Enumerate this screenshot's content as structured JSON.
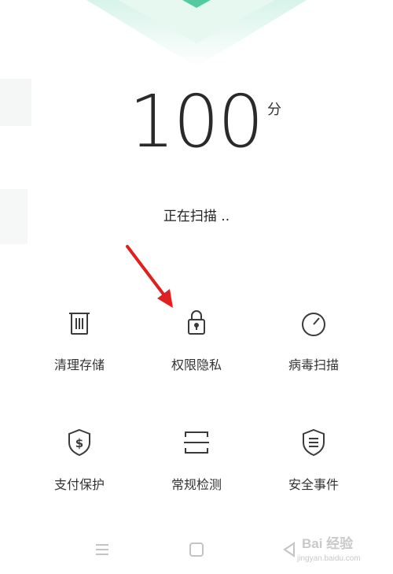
{
  "score": {
    "value": "100",
    "unit": "分"
  },
  "status": {
    "text": "正在扫描 .."
  },
  "tiles": [
    {
      "label": "清理存储",
      "icon": "trash-icon"
    },
    {
      "label": "权限隐私",
      "icon": "lock-icon"
    },
    {
      "label": "病毒扫描",
      "icon": "gauge-icon"
    },
    {
      "label": "支付保护",
      "icon": "shield-dollar-icon"
    },
    {
      "label": "常规检测",
      "icon": "scan-frame-icon"
    },
    {
      "label": "安全事件",
      "icon": "shield-list-icon"
    }
  ],
  "navbar": {
    "icons": [
      "menu-icon",
      "home-icon",
      "back-icon"
    ]
  },
  "watermark": {
    "brand": "Bai 经验",
    "url": "jingyan.baidu.com"
  },
  "colors": {
    "accent_green": "#54c8a0",
    "arrow_red": "#e02020",
    "icon_gray": "#3a3a3a"
  }
}
